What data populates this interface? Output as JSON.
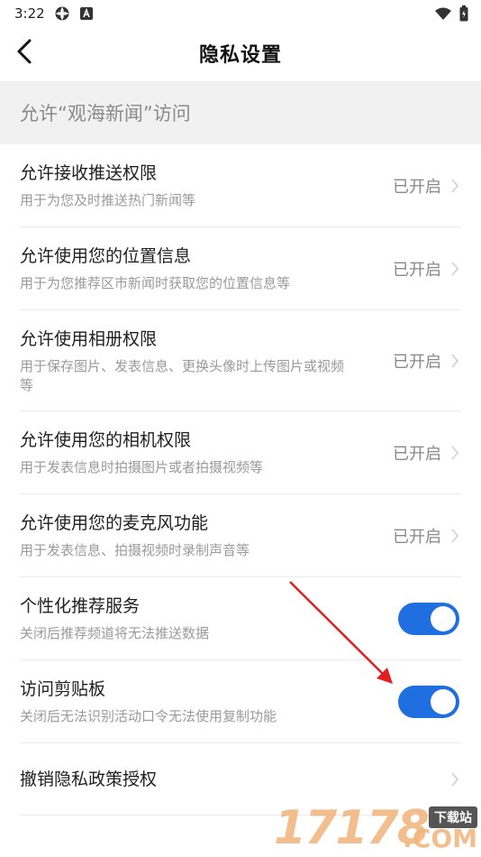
{
  "status_bar": {
    "time": "3:22",
    "icons_left": [
      "settings-cog-icon",
      "font-a-icon"
    ],
    "icons_right": [
      "wifi-icon",
      "battery-icon"
    ]
  },
  "header": {
    "back_icon": "chevron-left-icon",
    "title": "隐私设置"
  },
  "section": {
    "title": "允许“观海新闻”访问"
  },
  "rows": [
    {
      "title": "允许接收推送权限",
      "desc": "用于为您及时推送热门新闻等",
      "status": "已开启"
    },
    {
      "title": "允许使用您的位置信息",
      "desc": "用于为您推荐区市新闻时获取您的位置信息等",
      "status": "已开启"
    },
    {
      "title": "允许使用相册权限",
      "desc": "用于保存图片、发表信息、更换头像时上传图片或视频等",
      "status": "已开启"
    },
    {
      "title": "允许使用您的相机权限",
      "desc": "用于发表信息时拍摄图片或者拍摄视频等",
      "status": "已开启"
    },
    {
      "title": "允许使用您的麦克风功能",
      "desc": "用于发表信息、拍摄视频时录制声音等",
      "status": "已开启"
    }
  ],
  "toggles": [
    {
      "title": "个性化推荐服务",
      "desc": "关闭后推荐频道将无法推送数据",
      "on": true
    },
    {
      "title": "访问剪贴板",
      "desc": "关闭后无法识别活动口令无法使用复制功能",
      "on": true
    }
  ],
  "revoke": {
    "title": "撤销隐私政策授权"
  },
  "watermark": {
    "digits": "17178",
    "tag": "下载站",
    "com": ".COM"
  },
  "colors": {
    "toggle_on": "#1f6fe0",
    "annotation_arrow": "#e02020"
  }
}
